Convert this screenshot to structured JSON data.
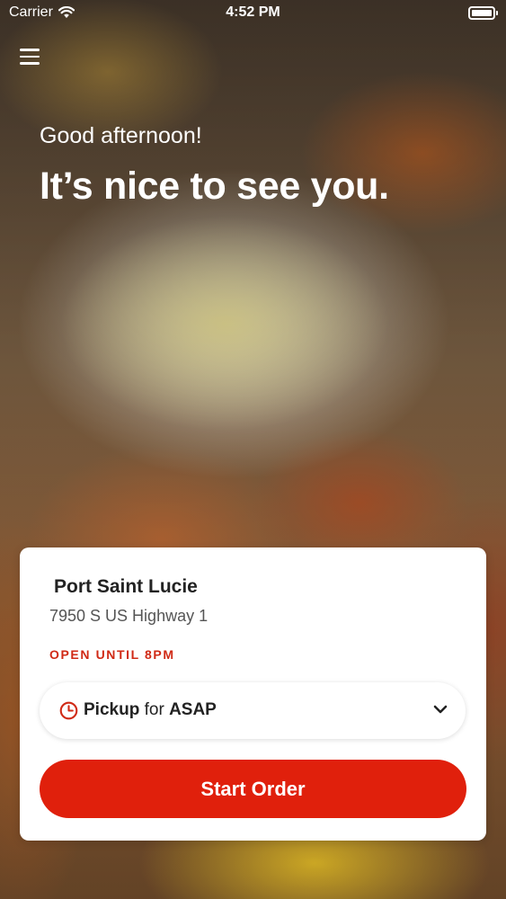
{
  "status_bar": {
    "carrier": "Carrier",
    "time": "4:52 PM",
    "icons": {
      "wifi": "wifi-icon",
      "battery": "battery-icon"
    }
  },
  "header": {
    "menu_icon": "hamburger-menu-icon"
  },
  "greeting": {
    "subtitle": "Good afternoon!",
    "headline": "It’s nice to see you."
  },
  "store_card": {
    "name": "Port Saint Lucie",
    "address": "7950 S US Highway 1",
    "hours": "OPEN UNTIL 8PM",
    "pickup": {
      "icon": "clock-icon",
      "mode": "Pickup",
      "connector": "for",
      "time": "ASAP",
      "dropdown_icon": "chevron-down-icon"
    },
    "start_button_label": "Start Order"
  },
  "colors": {
    "accent_red": "#e0200c",
    "hours_red": "#d02a16",
    "text_dark": "#222222",
    "text_gray": "#555555",
    "card_bg": "#ffffff"
  }
}
